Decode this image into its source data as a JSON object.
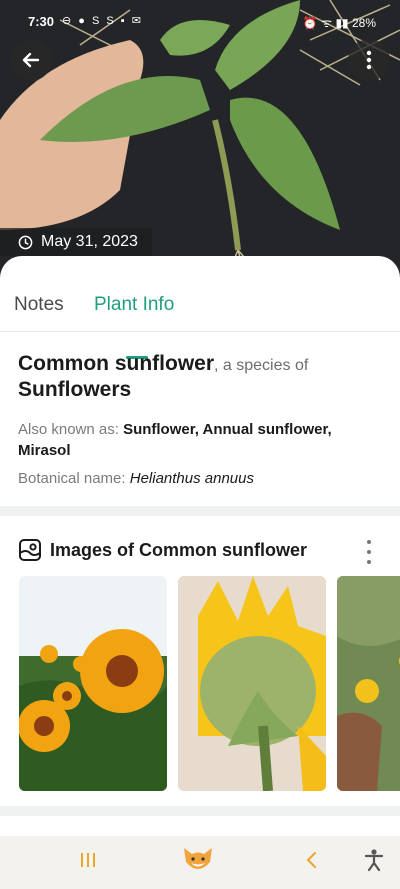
{
  "status_bar": {
    "time": "7:30",
    "left_icons": "⊖ ● S S ▪ ✉",
    "right_icons": "⏰ ᯤ ▮▮ 28%"
  },
  "hero": {
    "date": "May 31, 2023",
    "back_icon": "arrow-left-icon",
    "menu_icon": "more-vertical-icon"
  },
  "tabs": [
    {
      "label": "Notes",
      "active": false
    },
    {
      "label": "Plant Info",
      "active": true
    }
  ],
  "plant": {
    "common_name": "Common sunflower",
    "species_suffix": ", a species of",
    "genus": "Sunflowers",
    "aka_label": "Also known as: ",
    "aka_value": "Sunflower, Annual sunflower, Mirasol",
    "botanical_label": "Botanical name: ",
    "botanical_value": "Helianthus annuus"
  },
  "images": {
    "title": "Images of Common sunflower",
    "count_visible": 3
  },
  "colors": {
    "accent": "#1e9e80",
    "nav_icon": "#e6a92c"
  }
}
